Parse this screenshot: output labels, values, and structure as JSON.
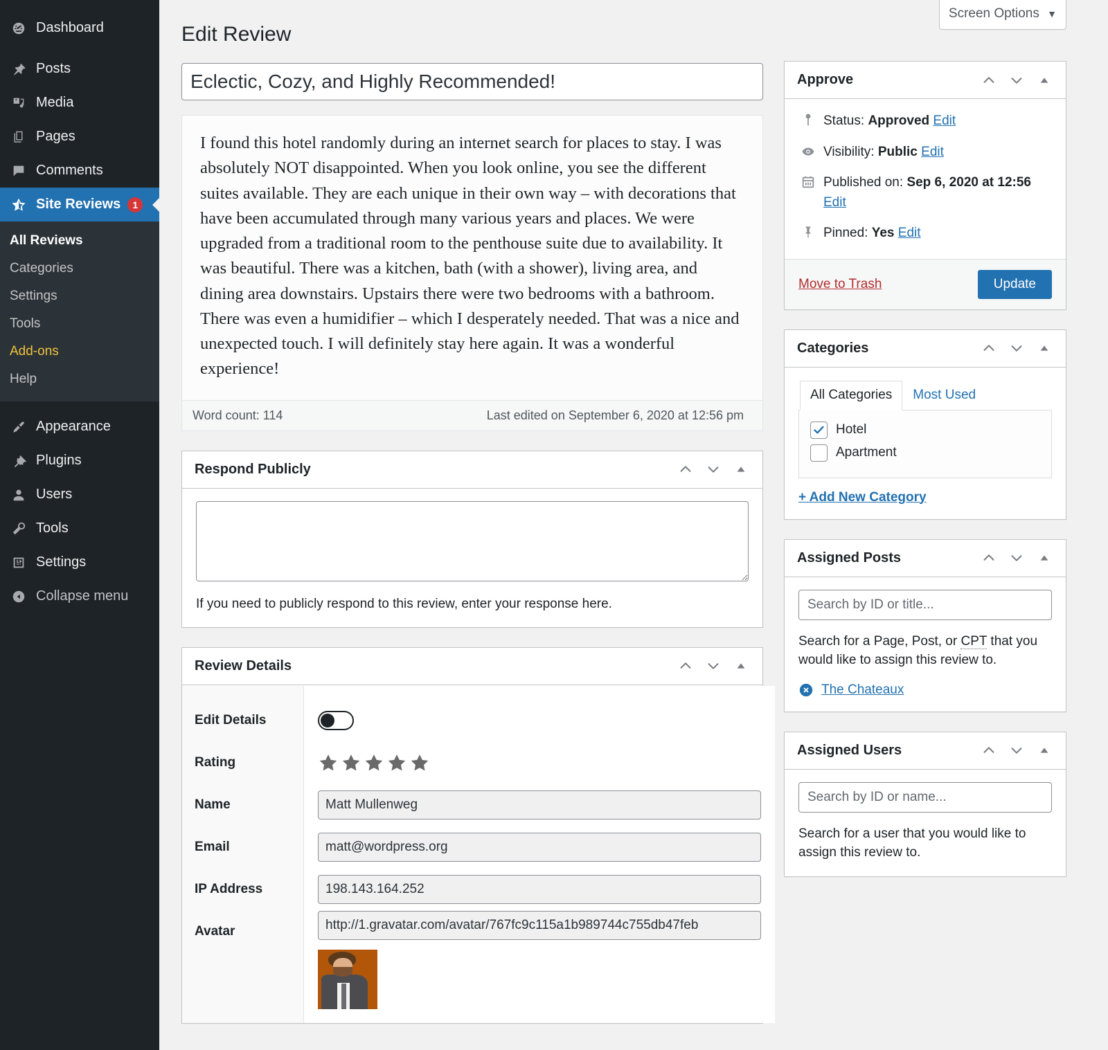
{
  "sidebar": {
    "items": [
      {
        "label": "Dashboard",
        "icon": "dashboard-icon",
        "name": "dashboard"
      },
      {
        "label": "Posts",
        "icon": "pin-icon",
        "name": "posts"
      },
      {
        "label": "Media",
        "icon": "media-icon",
        "name": "media"
      },
      {
        "label": "Pages",
        "icon": "pages-icon",
        "name": "pages"
      },
      {
        "label": "Comments",
        "icon": "comment-icon",
        "name": "comments"
      },
      {
        "label": "Site Reviews",
        "icon": "star-half-icon",
        "name": "site-reviews",
        "current": true,
        "badge": "1"
      }
    ],
    "submenu": [
      {
        "label": "All Reviews",
        "name": "all-reviews",
        "current": true
      },
      {
        "label": "Categories",
        "name": "categories"
      },
      {
        "label": "Settings",
        "name": "settings"
      },
      {
        "label": "Tools",
        "name": "tools"
      },
      {
        "label": "Add-ons",
        "name": "add-ons",
        "highlight": true
      },
      {
        "label": "Help",
        "name": "help"
      }
    ],
    "items_lower": [
      {
        "label": "Appearance",
        "icon": "brush-icon",
        "name": "appearance"
      },
      {
        "label": "Plugins",
        "icon": "plug-icon",
        "name": "plugins"
      },
      {
        "label": "Users",
        "icon": "user-icon",
        "name": "users"
      },
      {
        "label": "Tools",
        "icon": "wrench-icon",
        "name": "tools"
      },
      {
        "label": "Settings",
        "icon": "sliders-icon",
        "name": "settings"
      }
    ],
    "collapse_label": "Collapse menu",
    "accent_current": "#2271b1",
    "badge_color": "#d63638",
    "highlight_color": "#f0c33c"
  },
  "screen_options": {
    "label": "Screen Options",
    "caret": "▼"
  },
  "page": {
    "title": "Edit Review"
  },
  "title_field": {
    "value": "Eclectic, Cozy, and Highly Recommended!"
  },
  "editor": {
    "body": "I found this hotel randomly during an internet search for places to stay. I was absolutely NOT disappointed. When you look online, you see the different suites available. They are each unique in their own way – with decorations that have been accumulated through many various years and places. We were upgraded from a traditional room to the penthouse suite due to availability. It was beautiful. There was a kitchen, bath (with a shower), living area, and dining area downstairs. Upstairs there were two bedrooms with a bathroom. There was even a humidifier – which I desperately needed. That was a nice and unexpected touch. I will definitely stay here again. It was a wonderful experience!",
    "word_count": "Word count: 114",
    "last_edited": "Last edited on September 6, 2020 at 12:56 pm"
  },
  "respond_publicly": {
    "title": "Respond Publicly",
    "textarea_value": "",
    "help": "If you need to publicly respond to this review, enter your response here."
  },
  "review_details": {
    "title": "Review Details",
    "rows": [
      {
        "label": "Edit Details",
        "type": "toggle",
        "value": "off"
      },
      {
        "label": "Rating",
        "type": "stars",
        "value": 5,
        "max": 5
      },
      {
        "label": "Name",
        "type": "input",
        "value": "Matt Mullenweg"
      },
      {
        "label": "Email",
        "type": "input",
        "value": "matt@wordpress.org"
      },
      {
        "label": "IP Address",
        "type": "input",
        "value": "198.143.164.252"
      },
      {
        "label": "Avatar",
        "type": "input-image",
        "value": "http://1.gravatar.com/avatar/767fc9c115a1b989744c755db47feb"
      }
    ]
  },
  "approve": {
    "title": "Approve",
    "status_label": "Status:",
    "status_value": "Approved",
    "status_edit": "Edit",
    "visibility_label": "Visibility:",
    "visibility_value": "Public",
    "visibility_edit": "Edit",
    "published_label": "Published on:",
    "published_value": "Sep 6, 2020 at 12:56",
    "published_edit": "Edit",
    "pinned_label": "Pinned:",
    "pinned_value": "Yes",
    "pinned_edit": "Edit",
    "trash_label": "Move to Trash",
    "update_label": "Update",
    "update_color": "#2271b1",
    "trash_color": "#b32d2e"
  },
  "categories": {
    "title": "Categories",
    "tabs": [
      {
        "label": "All Categories",
        "active": true
      },
      {
        "label": "Most Used",
        "active": false
      }
    ],
    "items": [
      {
        "label": "Hotel",
        "checked": true
      },
      {
        "label": "Apartment",
        "checked": false
      }
    ],
    "add_new": "+ Add New Category"
  },
  "assigned_posts": {
    "title": "Assigned Posts",
    "search_placeholder": "Search by ID or title...",
    "search_value": "",
    "help_before": "Search for a Page, Post, or ",
    "help_abbr": "CPT",
    "help_after": " that you would like to assign this review to.",
    "items": [
      {
        "label": "The Chateaux"
      }
    ]
  },
  "assigned_users": {
    "title": "Assigned Users",
    "search_placeholder": "Search by ID or name...",
    "search_value": "",
    "help": "Search for a user that you would like to assign this review to."
  }
}
